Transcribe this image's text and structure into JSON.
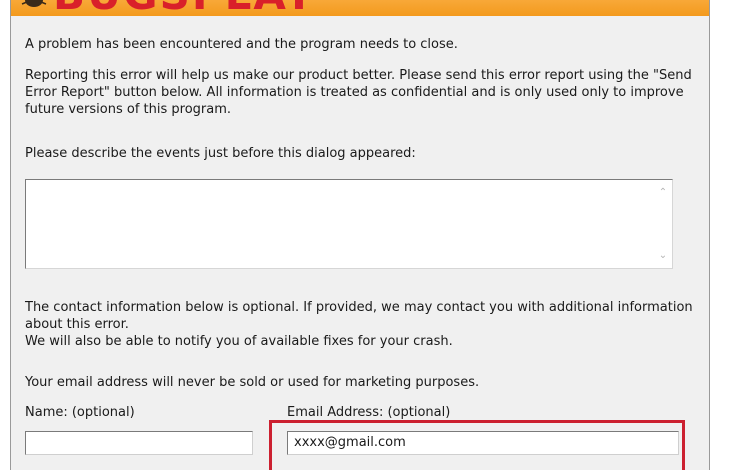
{
  "banner": {
    "title": "BUGSPLAT",
    "logo_icon": "bug-logo-icon",
    "background_color": "#f39a1d",
    "title_color": "#d9202a"
  },
  "messages": {
    "problem": "A problem has been encountered and the program needs to close.",
    "reporting": "Reporting this error will help us make our product better. Please send this error report using the \"Send Error Report\" button below. All information is treated as confidential and is only used only to improve future versions of this program.",
    "describe_prompt": "Please describe the events just before this dialog appeared:",
    "contact": "The contact information below is optional. If provided, we may contact you with additional information about this error.\nWe will also be able to notify you of available fixes for your crash.",
    "privacy": "Your email address will never be sold or used for marketing purposes."
  },
  "events_box": {
    "value": ""
  },
  "form": {
    "name_label": "Name: (optional)",
    "name_value": "",
    "email_label": "Email Address: (optional)",
    "email_value": "xxxx@gmail.com"
  },
  "highlight_color": "#cc2030"
}
